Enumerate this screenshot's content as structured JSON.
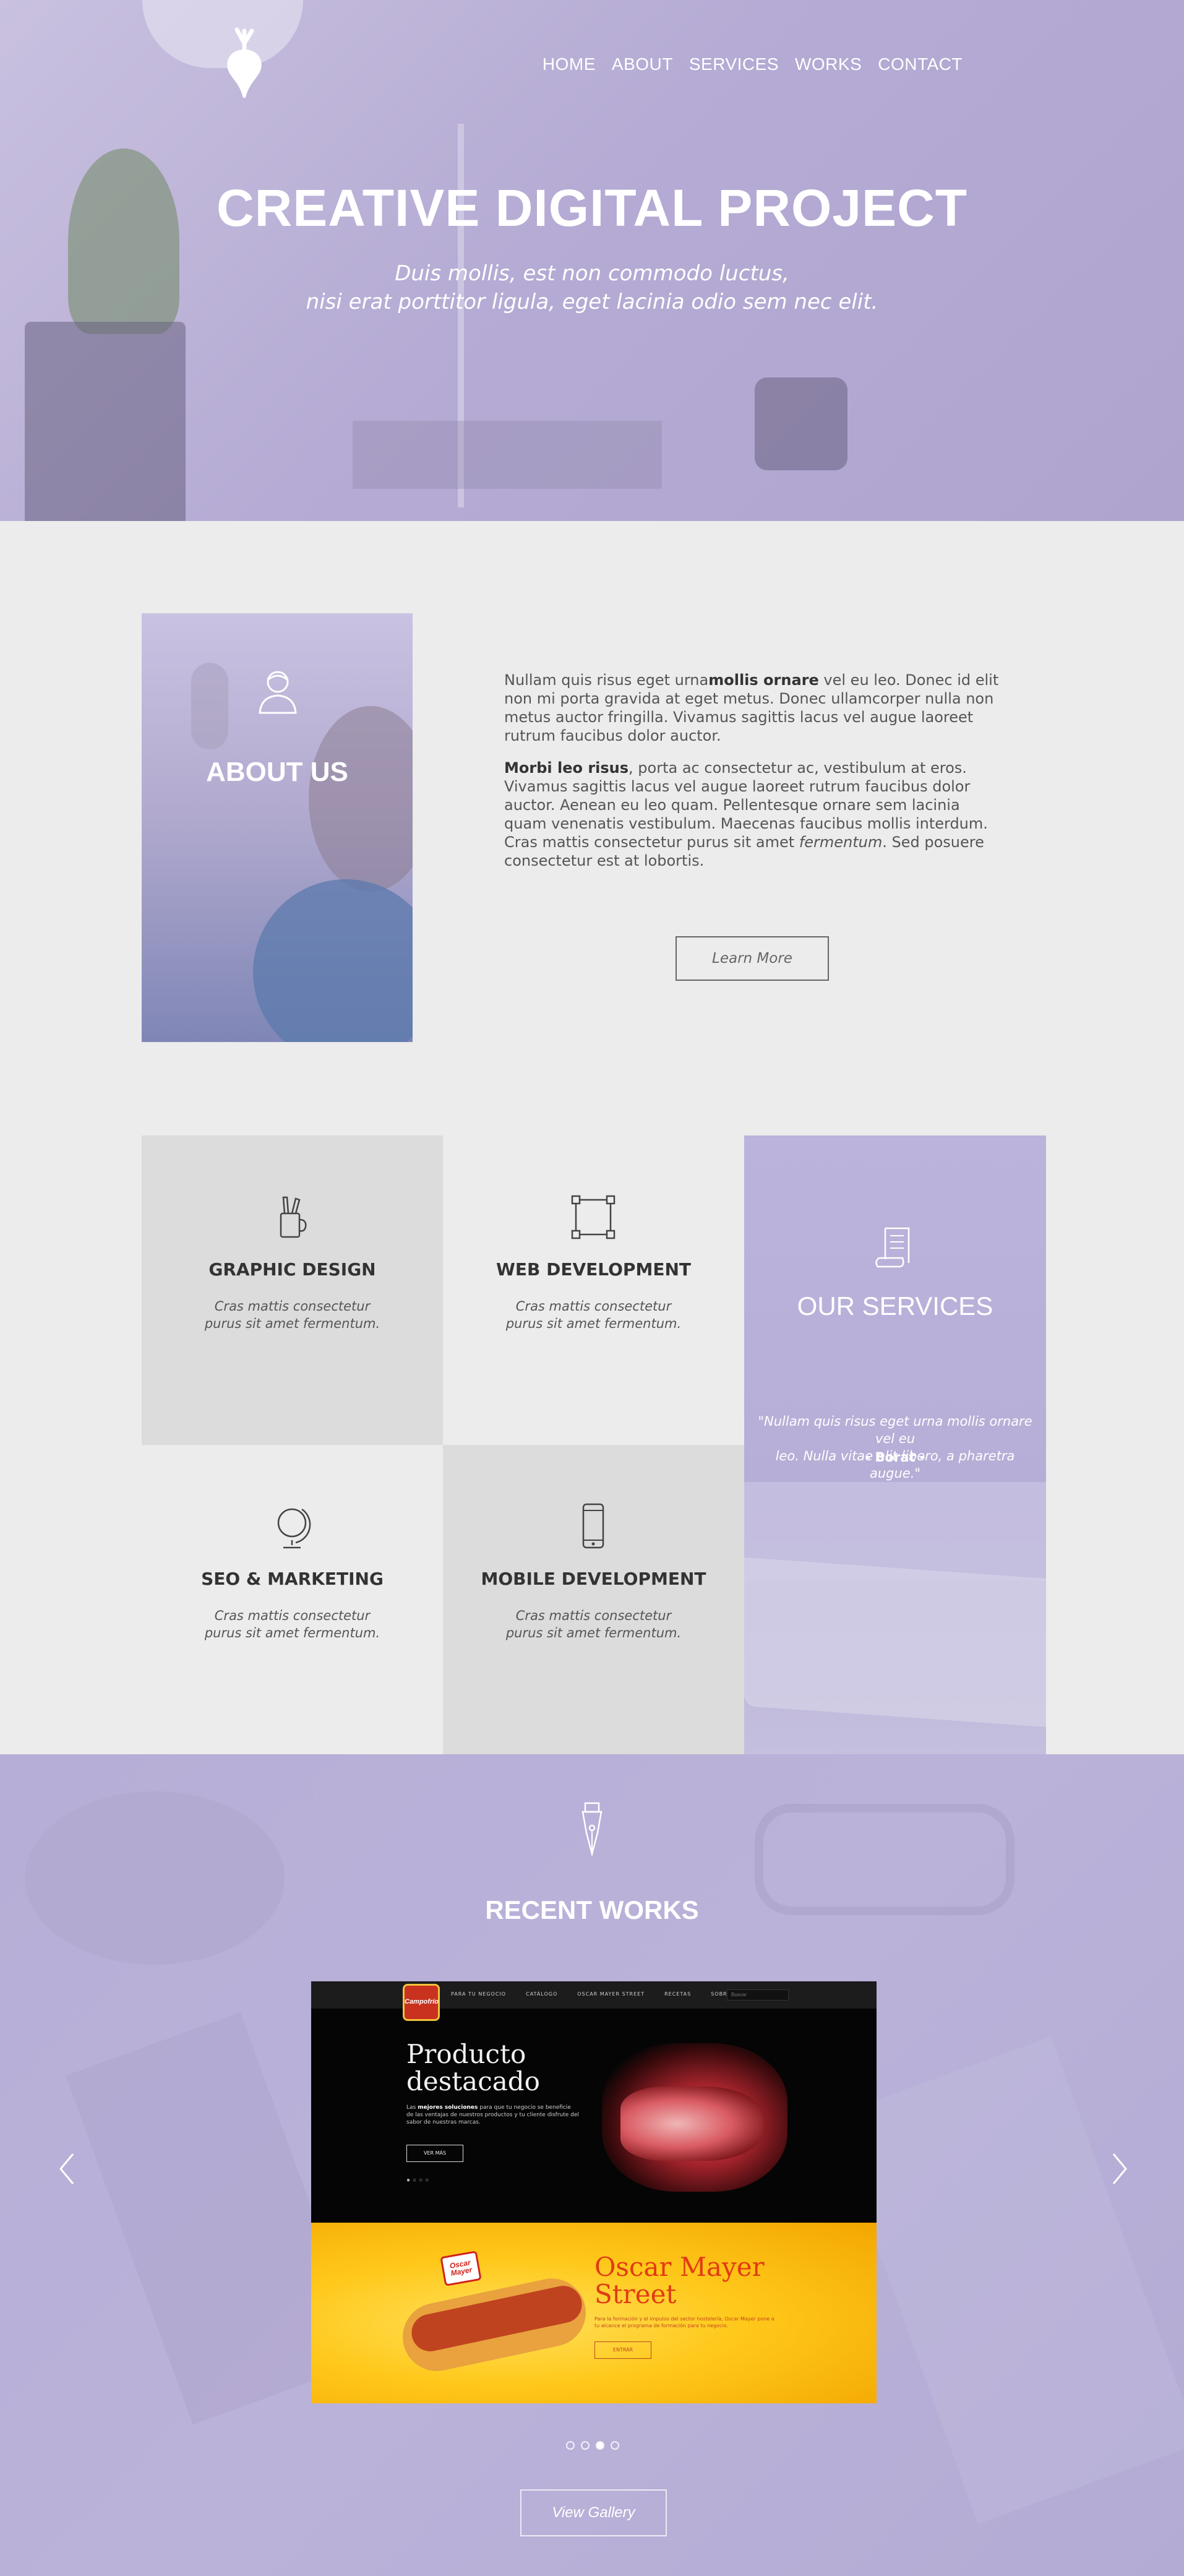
{
  "nav": {
    "items": [
      "HOME",
      "ABOUT",
      "SERVICES",
      "WORKS",
      "CONTACT"
    ]
  },
  "hero": {
    "title": "CREATIVE DIGITAL PROJECT",
    "subtitle_line1": "Duis mollis, est non commodo luctus,",
    "subtitle_line2": "nisi erat porttitor ligula, eget lacinia odio sem nec elit."
  },
  "about": {
    "title": "ABOUT US",
    "p1_pre": "Nullam quis risus eget urna",
    "p1_bold": "mollis ornare",
    "p1_post": " vel eu leo. Donec id elit non mi porta gravida at eget metus. Donec ullamcorper nulla non metus auctor fringilla. Vivamus sagittis lacus vel augue laoreet rutrum faucibus dolor auctor.",
    "p2_bold": "Morbi leo risus",
    "p2_mid": ", porta ac consectetur ac, vestibulum at eros. Vivamus sagittis lacus vel augue laoreet rutrum faucibus dolor auctor. Aenean eu leo quam. Pellentesque ornare sem lacinia quam venenatis vestibulum. Maecenas faucibus mollis interdum. Cras mattis consectetur purus sit amet ",
    "p2_italic": "fermentum",
    "p2_post": ". Sed posuere consectetur est at lobortis.",
    "button": "Learn More"
  },
  "services": {
    "items": [
      {
        "title": "GRAPHIC DESIGN",
        "line1": "Cras mattis consectetur",
        "line2": "purus sit amet fermentum.",
        "icon": "pencil-cup-icon"
      },
      {
        "title": "WEB DEVELOPMENT",
        "line1": "Cras mattis consectetur",
        "line2": "purus sit amet fermentum.",
        "icon": "vector-square-icon"
      },
      {
        "title": "SEO & MARKETING",
        "line1": "Cras mattis consectetur",
        "line2": "purus sit amet fermentum.",
        "icon": "globe-icon"
      },
      {
        "title": "MOBILE DEVELOPMENT",
        "line1": "Cras mattis consectetur",
        "line2": "purus sit amet fermentum.",
        "icon": "smartphone-icon"
      }
    ],
    "panel": {
      "title": "OUR SERVICES",
      "quote_line1": "\"Nullam quis risus eget urna mollis ornare vel eu",
      "quote_line2": "leo. Nulla vitae elit libero, a pharetra augue.\"",
      "author": "- Borat -",
      "icon": "scroll-icon"
    }
  },
  "works": {
    "title": "RECENT WORKS",
    "icon": "pen-nib-icon",
    "button": "View Gallery",
    "active_slide": 3,
    "slide_count": 4,
    "slide": {
      "brand": "Campofrío",
      "menu": [
        "PARA TU NEGOCIO",
        "CATÁLOGO",
        "OSCAR MAYER STREET",
        "RECETAS",
        "SOBRE CAMPOFRÍO"
      ],
      "search": "Buscar",
      "heading_line1": "Producto",
      "heading_line2": "destacado",
      "desc_pre": "Las ",
      "desc_bold": "mejores soluciones",
      "desc_post": " para que tu negocio se beneficie de las ventajas de nuestros productos y tu cliente disfrute del sabor de nuestras marcas.",
      "btn": "VER MÁS",
      "om_logo": "Oscar Mayer",
      "om_heading_line1": "Oscar Mayer",
      "om_heading_line2": "Street",
      "om_desc": "Para la formación y el impulso del sector hostelería, Oscar Mayer pone a tu alcance el programa de formación para tu negocio.",
      "om_btn": "ENTRAR"
    }
  },
  "colors": {
    "accent_lavender": "#b6aed6",
    "page_bg": "#ececec",
    "card_grey": "#dcdcdc",
    "text_dark": "#333333"
  }
}
